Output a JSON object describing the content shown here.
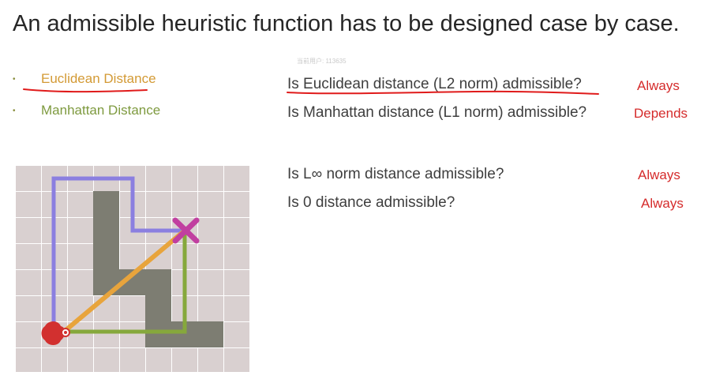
{
  "slide": {
    "title": "An admissible heuristic function has to be designed case by case.",
    "watermark": "当前用户: 113635"
  },
  "bullets": [
    {
      "text": "Euclidean Distance",
      "color": "#d39a35"
    },
    {
      "text": "Manhattan Distance",
      "color": "#7e9a3f"
    }
  ],
  "questions": [
    {
      "question": "Is Euclidean distance (L2 norm) admissible?",
      "answer": "Always"
    },
    {
      "question": "Is Manhattan distance (L1 norm) admissible?",
      "answer": "Depends"
    },
    {
      "question": "Is L∞ norm distance admissible?",
      "answer": "Always"
    },
    {
      "question": "Is 0 distance admissible?",
      "answer": "Always"
    }
  ],
  "colors": {
    "grid_background": "#d9d0d0",
    "grid_lines": "#ffffff",
    "obstacle": "#7d7d72",
    "path_purple": "#8b7fe0",
    "path_orange": "#e8a43c",
    "path_green": "#86a83c",
    "goal_marker": "#c13fa0",
    "start_marker": "#d2302f",
    "annotation_ink": "#e01b1b"
  },
  "icons": {
    "goal": "x-mark-icon",
    "start": "start-blob-icon"
  }
}
